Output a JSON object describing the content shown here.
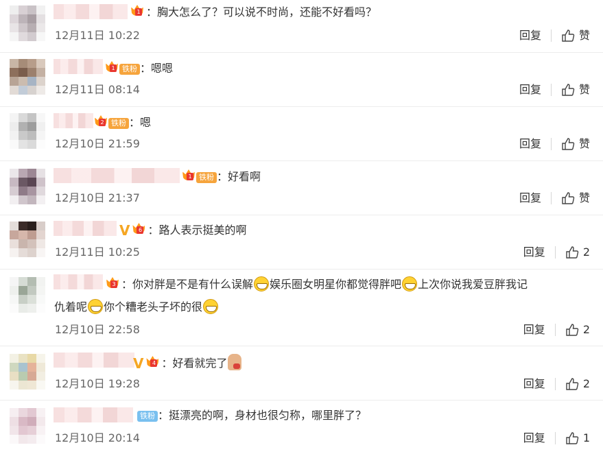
{
  "comments": [
    {
      "text": "：胸大怎么了？可以说不时尚，还能不好看吗？",
      "time": "12月11日 10:22",
      "reply": "回复",
      "like": "赞",
      "badge_level": "1",
      "fan_tag": "",
      "verified": false
    },
    {
      "text": "：嗯嗯",
      "time": "12月11日 08:14",
      "reply": "回复",
      "like": "赞",
      "badge_level": "1",
      "fan_tag": "铁粉",
      "verified": false
    },
    {
      "text": "：嗯",
      "time": "12月10日 21:59",
      "reply": "回复",
      "like": "赞",
      "badge_level": "2",
      "fan_tag": "铁粉",
      "verified": false
    },
    {
      "text": "：好看啊",
      "time": "12月10日 21:37",
      "reply": "回复",
      "like": "赞",
      "badge_level": "1",
      "fan_tag": "铁粉",
      "verified": false
    },
    {
      "text": "：路人表示挺美的啊",
      "time": "12月11日 10:25",
      "reply": "回复",
      "like": "2",
      "badge_level": "6",
      "fan_tag": "",
      "verified": true
    },
    {
      "text_parts": [
        "：你对胖是不是有什么误解",
        "娱乐圈女明星你都觉得胖吧",
        "上次你说我爱豆胖我记"
      ],
      "text_line2": [
        "仇着呢",
        "你个糟老头子坏的很"
      ],
      "time": "12月10日 22:58",
      "reply": "回复",
      "like": "2",
      "badge_level": "3",
      "fan_tag": "",
      "verified": false
    },
    {
      "text": "：好看就完了",
      "time": "12月10日 19:28",
      "reply": "回复",
      "like": "2",
      "badge_level": "4",
      "fan_tag": "",
      "verified": true
    },
    {
      "text": "：挺漂亮的啊，身材也很匀称，哪里胖了？",
      "time": "12月10日 20:14",
      "reply": "回复",
      "like": "1",
      "badge_level": "",
      "fan_tag": "铁粉",
      "verified": false
    }
  ],
  "colors": {
    "badge": "#f6a43c",
    "fan_blue": "#79c0ef",
    "verified": "#f5a623",
    "time": "#666666"
  },
  "icons": {
    "like": "thumbs-up-icon",
    "laugh": "grin-emoji-icon",
    "crown": "fan-crown-icon"
  }
}
